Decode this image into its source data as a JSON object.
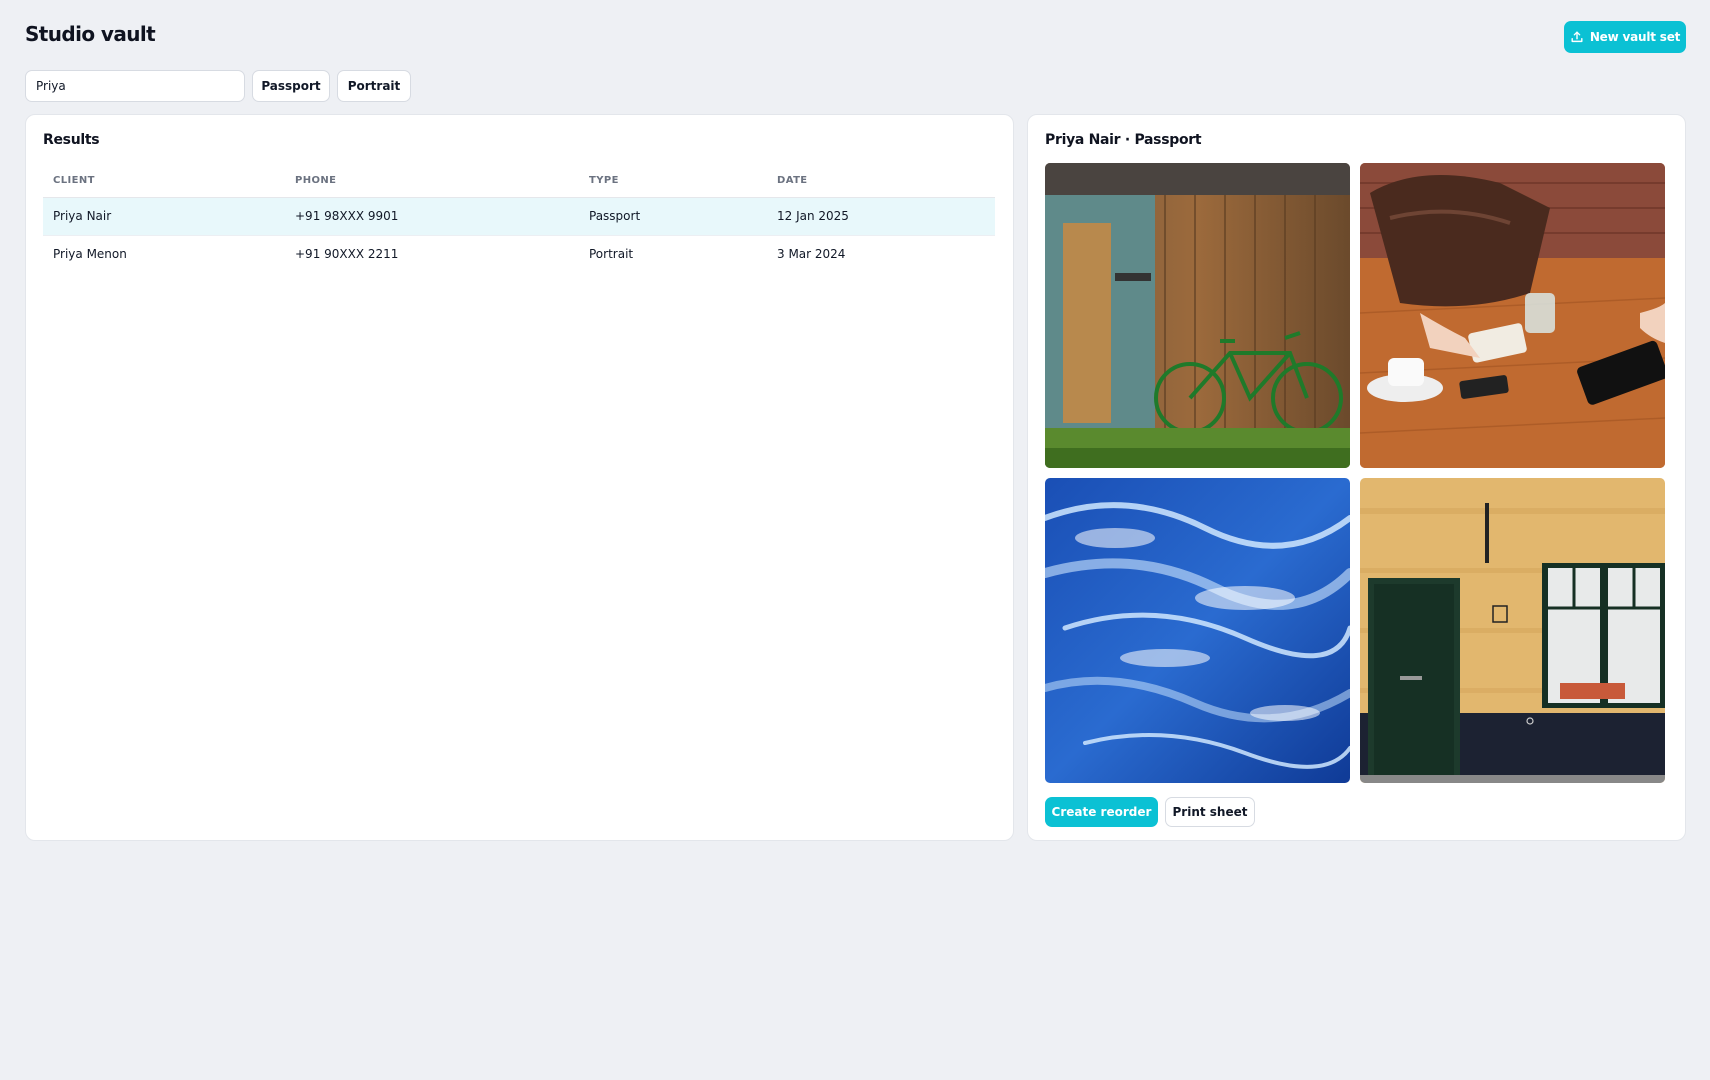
{
  "app": {
    "title": "Studio vault"
  },
  "header": {
    "new_button_label": "New vault set",
    "new_button_icon": "upload-icon"
  },
  "filters": {
    "search_value": "Priya",
    "chips": [
      "Passport",
      "Portrait"
    ]
  },
  "results": {
    "title": "Results",
    "columns": [
      "CLIENT",
      "PHONE",
      "TYPE",
      "DATE"
    ],
    "rows": [
      {
        "client": "Priya Nair",
        "phone": "+91 98XXX 9901",
        "type": "Passport",
        "date": "12 Jan 2025",
        "selected": true
      },
      {
        "client": "Priya Menon",
        "phone": "+91 90XXX 2211",
        "type": "Portrait",
        "date": "3 Mar 2024",
        "selected": false
      }
    ]
  },
  "detail": {
    "title": "Priya Nair · Passport",
    "photos": [
      "bicycle-shed-photo",
      "cafe-table-photo",
      "ocean-waves-photo",
      "green-door-photo"
    ],
    "primary_action": "Create reorder",
    "secondary_action": "Print sheet"
  },
  "colors": {
    "accent": "#0bc1d4",
    "selected_row": "#e8f8fb",
    "background": "#eef0f4"
  }
}
